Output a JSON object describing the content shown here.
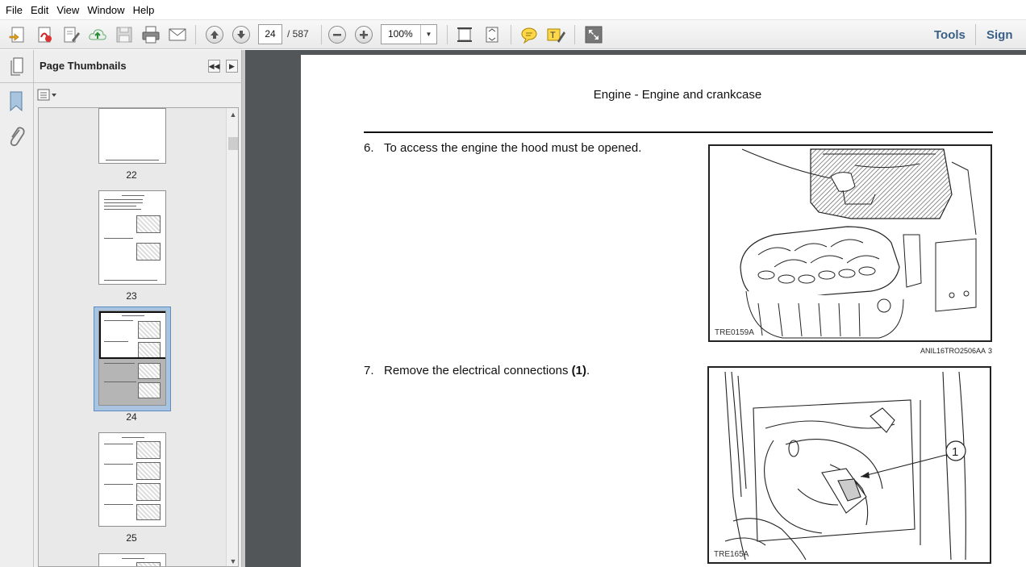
{
  "menu": [
    "File",
    "Edit",
    "View",
    "Window",
    "Help"
  ],
  "toolbar": {
    "current_page": "24",
    "page_total": "/ 587",
    "zoom": "100%",
    "tools_label": "Tools",
    "sign_label": "Sign"
  },
  "panel": {
    "title": "Page Thumbnails",
    "thumbnails": [
      {
        "label": "22"
      },
      {
        "label": "23"
      },
      {
        "label": "24"
      },
      {
        "label": "25"
      }
    ]
  },
  "document": {
    "heading": "Engine - Engine and crankcase",
    "steps": [
      {
        "number": "6.",
        "text": "To access the engine the hood must be opened."
      },
      {
        "number": "7.",
        "text_plain": "Remove the electrical connections ",
        "text_bold": "(1)",
        "text_end": "."
      }
    ],
    "figures": [
      {
        "code": "TRE0159A",
        "reference": "ANIL16TRO2506AA",
        "index": "3"
      },
      {
        "code": "TRE165A",
        "callout": "1"
      }
    ]
  }
}
